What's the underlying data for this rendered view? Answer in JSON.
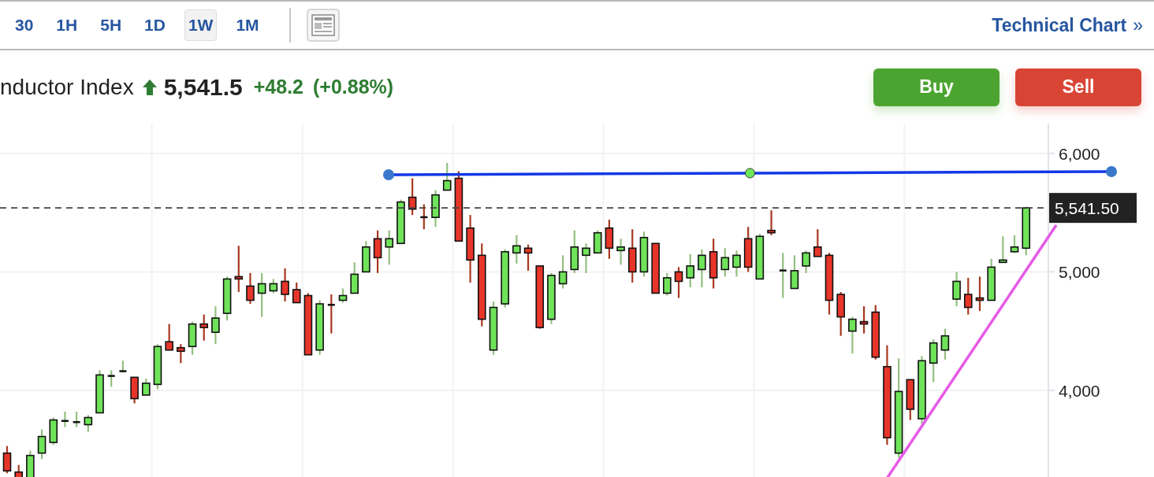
{
  "toolbar": {
    "intervals": [
      {
        "label": "30",
        "selected": false
      },
      {
        "label": "1H",
        "selected": false
      },
      {
        "label": "5H",
        "selected": false
      },
      {
        "label": "1D",
        "selected": false
      },
      {
        "label": "1W",
        "selected": true
      },
      {
        "label": "1M",
        "selected": false
      }
    ],
    "link": {
      "label": "Technical Chart",
      "chevron": "»"
    }
  },
  "quote": {
    "name": "nductor Index",
    "up": true,
    "price": "5,541.5",
    "change": "+48.2",
    "change_percent": "(+0.88%)"
  },
  "actions": [
    {
      "label": "Buy",
      "kind": "buy"
    },
    {
      "label": "Sell",
      "kind": "sell"
    }
  ],
  "chart": {
    "last_price_tag": "5,541.50",
    "chart_data": {
      "type": "candlestick",
      "grid": true,
      "ylim": [
        3255,
        6252
      ],
      "yticks": [
        {
          "value": 4000,
          "label": "4,000"
        },
        {
          "value": 5000,
          "label": "5,000"
        },
        {
          "value": 6000,
          "label": "6,000"
        }
      ],
      "ref_lines": [
        {
          "axis": "y",
          "value": 5540
        }
      ],
      "ohlc": [
        [
          3470,
          3530,
          3300,
          3320
        ],
        [
          3310,
          3370,
          3260,
          3260
        ],
        [
          3260,
          3490,
          3260,
          3450
        ],
        [
          3470,
          3670,
          3420,
          3610
        ],
        [
          3560,
          3770,
          3540,
          3750
        ],
        [
          3740,
          3820,
          3690,
          3750
        ],
        [
          3730,
          3820,
          3690,
          3740
        ],
        [
          3710,
          3790,
          3650,
          3770
        ],
        [
          3810,
          4170,
          3810,
          4130
        ],
        [
          4120,
          4170,
          4030,
          4130
        ],
        [
          4165,
          4250,
          4150,
          4170
        ],
        [
          4110,
          4110,
          3890,
          3930
        ],
        [
          3960,
          4100,
          3960,
          4060
        ],
        [
          4050,
          4390,
          4010,
          4370
        ],
        [
          4410,
          4560,
          4340,
          4340
        ],
        [
          4360,
          4390,
          4230,
          4330
        ],
        [
          4370,
          4580,
          4300,
          4560
        ],
        [
          4560,
          4640,
          4420,
          4530
        ],
        [
          4490,
          4710,
          4390,
          4610
        ],
        [
          4650,
          4960,
          4590,
          4940
        ],
        [
          4960,
          5220,
          4830,
          4940
        ],
        [
          4880,
          4990,
          4730,
          4760
        ],
        [
          4820,
          4990,
          4620,
          4900
        ],
        [
          4840,
          4940,
          4820,
          4900
        ],
        [
          4920,
          5030,
          4750,
          4810
        ],
        [
          4850,
          4910,
          4740,
          4740
        ],
        [
          4800,
          4820,
          4300,
          4300
        ],
        [
          4340,
          4760,
          4300,
          4730
        ],
        [
          4730,
          4810,
          4480,
          4720
        ],
        [
          4760,
          4860,
          4740,
          4800
        ],
        [
          4820,
          5080,
          4820,
          4980
        ],
        [
          5000,
          5260,
          5000,
          5210
        ],
        [
          5280,
          5350,
          4990,
          5120
        ],
        [
          5210,
          5350,
          5060,
          5280
        ],
        [
          5240,
          5610,
          5240,
          5590
        ],
        [
          5630,
          5790,
          5480,
          5530
        ],
        [
          5470,
          5570,
          5360,
          5460
        ],
        [
          5460,
          5690,
          5380,
          5650
        ],
        [
          5690,
          5920,
          5690,
          5770
        ],
        [
          5790,
          5850,
          5260,
          5260
        ],
        [
          5370,
          5480,
          4910,
          5100
        ],
        [
          5140,
          5240,
          4540,
          4600
        ],
        [
          4340,
          4750,
          4300,
          4700
        ],
        [
          4730,
          5190,
          4700,
          5170
        ],
        [
          5160,
          5310,
          5070,
          5220
        ],
        [
          5200,
          5230,
          5010,
          5160
        ],
        [
          5050,
          5050,
          4520,
          4530
        ],
        [
          4600,
          4990,
          4560,
          4970
        ],
        [
          4900,
          5140,
          4860,
          5000
        ],
        [
          5020,
          5350,
          4990,
          5210
        ],
        [
          5140,
          5240,
          4990,
          5200
        ],
        [
          5160,
          5350,
          5160,
          5330
        ],
        [
          5370,
          5440,
          5110,
          5200
        ],
        [
          5180,
          5280,
          5060,
          5210
        ],
        [
          5200,
          5360,
          4910,
          5000
        ],
        [
          5000,
          5340,
          4960,
          5290
        ],
        [
          5240,
          5240,
          4820,
          4820
        ],
        [
          4820,
          4990,
          4800,
          4950
        ],
        [
          5000,
          5040,
          4780,
          4920
        ],
        [
          4950,
          5150,
          4870,
          5050
        ],
        [
          5020,
          5190,
          4870,
          5140
        ],
        [
          5170,
          5280,
          4860,
          4950
        ],
        [
          5020,
          5200,
          4960,
          5120
        ],
        [
          5040,
          5180,
          4960,
          5140
        ],
        [
          5280,
          5380,
          5000,
          5040
        ],
        [
          4940,
          5320,
          4940,
          5300
        ],
        [
          5350,
          5520,
          5310,
          5330
        ],
        [
          5010,
          5160,
          4780,
          5020
        ],
        [
          4860,
          5140,
          4860,
          5010
        ],
        [
          5050,
          5180,
          4990,
          5160
        ],
        [
          5210,
          5360,
          5130,
          5130
        ],
        [
          5140,
          5160,
          4640,
          4760
        ],
        [
          4810,
          4830,
          4460,
          4620
        ],
        [
          4500,
          4620,
          4310,
          4600
        ],
        [
          4580,
          4710,
          4480,
          4560
        ],
        [
          4660,
          4720,
          4260,
          4280
        ],
        [
          4200,
          4380,
          3540,
          3600
        ],
        [
          3470,
          4270,
          3430,
          3990
        ],
        [
          4090,
          4090,
          3750,
          3840
        ],
        [
          3760,
          4290,
          3720,
          4250
        ],
        [
          4230,
          4430,
          4070,
          4400
        ],
        [
          4340,
          4520,
          4260,
          4460
        ],
        [
          4770,
          5000,
          4710,
          4920
        ],
        [
          4810,
          4950,
          4640,
          4700
        ],
        [
          4780,
          4960,
          4670,
          4760
        ],
        [
          4760,
          5110,
          4760,
          5040
        ],
        [
          5080,
          5300,
          5080,
          5100
        ],
        [
          5170,
          5310,
          5160,
          5210
        ],
        [
          5200,
          5550,
          5140,
          5540
        ]
      ]
    }
  }
}
